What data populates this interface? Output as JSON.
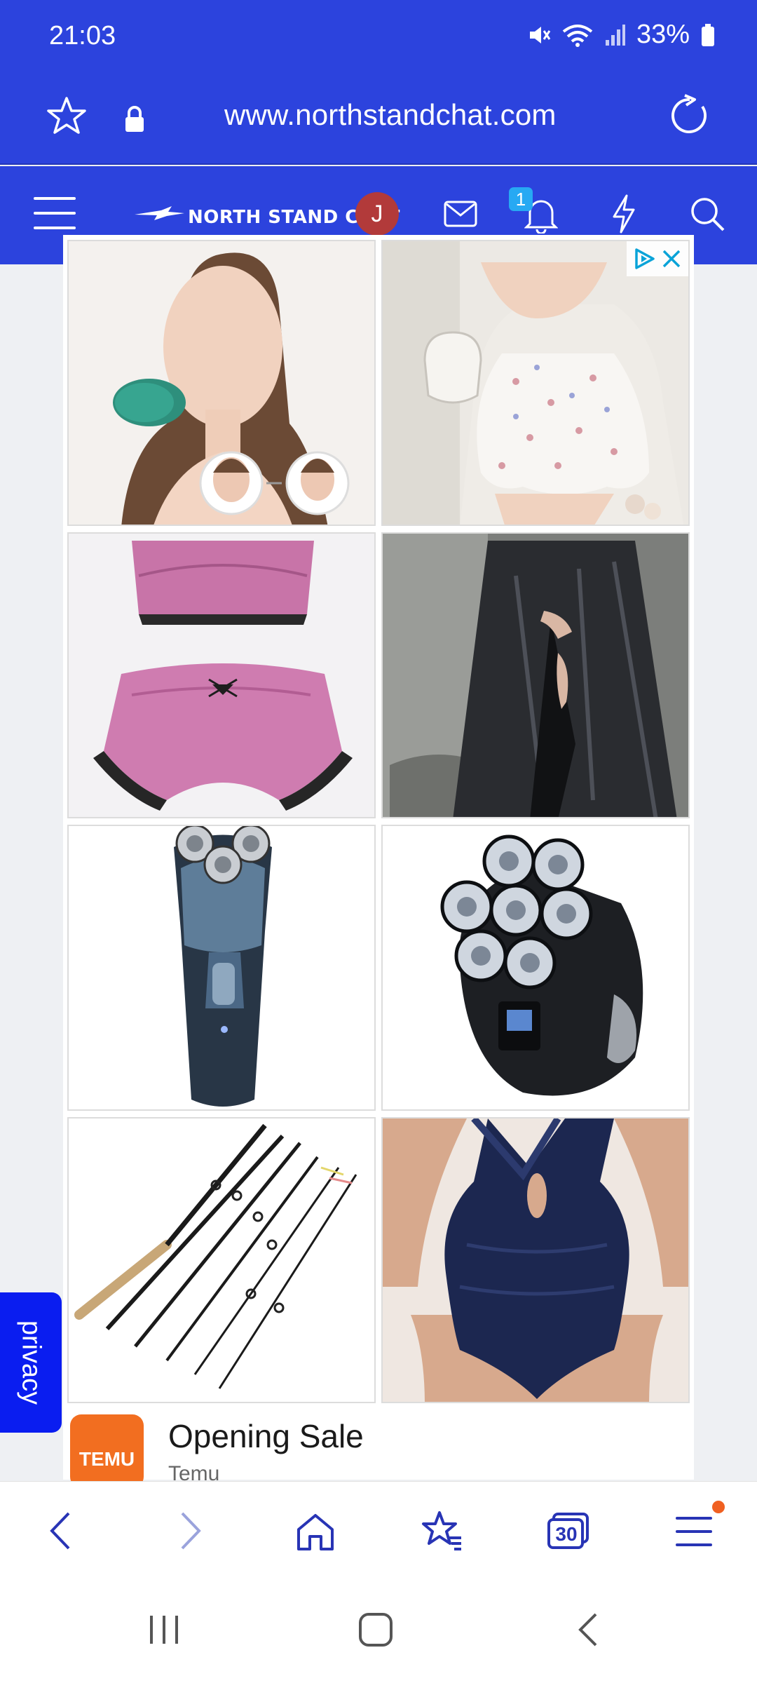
{
  "status": {
    "time": "21:03",
    "battery": "33%",
    "icons": [
      "mute-icon",
      "wifi-icon",
      "signal-icon",
      "battery-icon"
    ]
  },
  "browser": {
    "url": "www.northstandchat.com",
    "icons": [
      "bookmark-star-icon",
      "lock-icon",
      "reload-icon"
    ]
  },
  "site_header": {
    "logo_text": "NORTH STAND CHAT",
    "avatar_letter": "J",
    "notification_count": "1",
    "icons": [
      "menu-icon",
      "mail-icon",
      "bell-icon",
      "lightning-icon",
      "search-icon"
    ]
  },
  "ad": {
    "tiles": [
      "face-slimmer-product",
      "floral-pajama-product",
      "pink-satin-lingerie-product",
      "leather-skirt-product",
      "rotary-shaver-product",
      "head-shaver-product",
      "fishing-rod-set-product",
      "navy-swimsuit-product"
    ],
    "brand_logo_text": "TEMU",
    "title": "Opening Sale",
    "subtitle": "Temu"
  },
  "privacy_label": "privacy",
  "bottom_nav": {
    "tab_count": "30",
    "icons": [
      "back-icon",
      "forward-icon",
      "home-icon",
      "bookmarks-icon",
      "tabs-icon",
      "menu-icon"
    ]
  },
  "colors": {
    "brand_blue": "#2c43dd",
    "privacy_blue": "#0a1df0",
    "temu_orange": "#f26e20",
    "nav_icon": "#2834b5"
  }
}
